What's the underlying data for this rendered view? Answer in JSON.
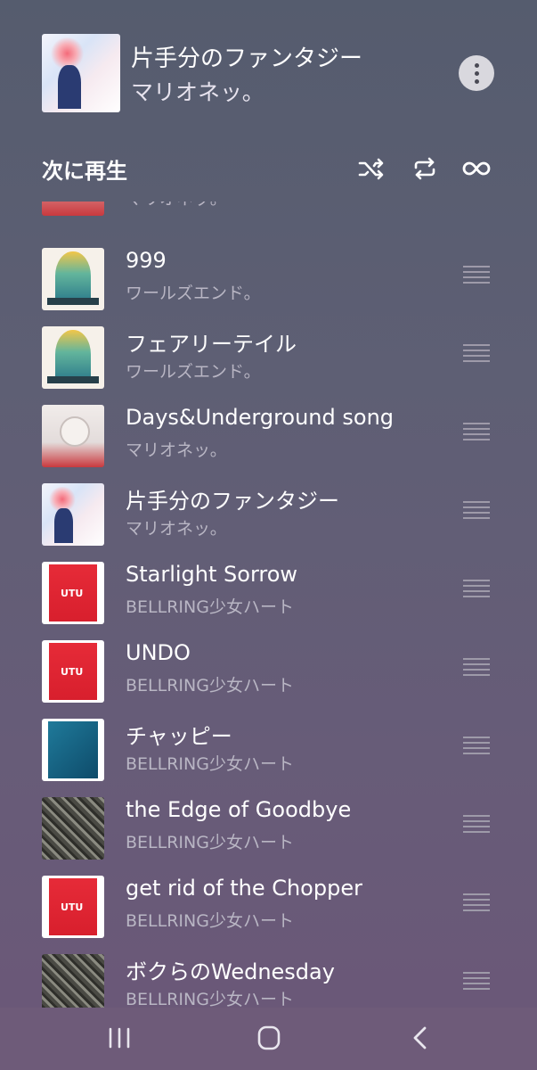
{
  "now_playing": {
    "title": "片手分のファンタジー",
    "artist": "マリオネッ。",
    "art": "album-art-katatebun"
  },
  "queue_header": {
    "label": "次に再生",
    "controls": [
      "shuffle-icon",
      "repeat-icon",
      "infinite-icon"
    ]
  },
  "queue": {
    "partial_top": {
      "artist": "マリオネッ。"
    },
    "items": [
      {
        "title": "999",
        "artist": "ワールズエンド。",
        "art": "world"
      },
      {
        "title": "フェアリーテイル",
        "artist": "ワールズエンド。",
        "art": "world"
      },
      {
        "title": "Days&Underground song",
        "artist": "マリオネッ。",
        "art": "days"
      },
      {
        "title": "片手分のファンタジー",
        "artist": "マリオネッ。",
        "art": "kata"
      },
      {
        "title": "Starlight Sorrow",
        "artist": "BELLRING少女ハート",
        "art": "red"
      },
      {
        "title": "UNDO",
        "artist": "BELLRING少女ハート",
        "art": "red"
      },
      {
        "title": "チャッピー",
        "artist": "BELLRING少女ハート",
        "art": "blue"
      },
      {
        "title": "the Edge of Goodbye",
        "artist": "BELLRING少女ハート",
        "art": "dark"
      },
      {
        "title": "get rid of the Chopper",
        "artist": "BELLRING少女ハート",
        "art": "red"
      },
      {
        "title": "ボクらのWednesday",
        "artist": "BELLRING少女ハート",
        "art": "dark"
      }
    ]
  },
  "navbar": [
    "recents-icon",
    "home-icon",
    "back-icon"
  ]
}
